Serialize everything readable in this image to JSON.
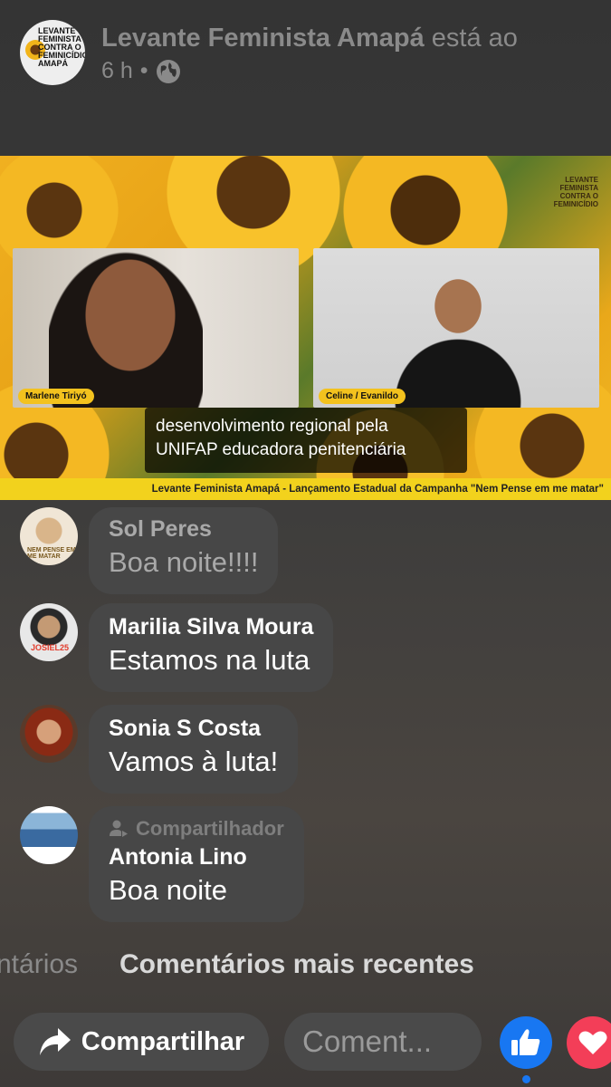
{
  "header": {
    "page_name": "Levante Feminista Amapá",
    "status_suffix": "está ao",
    "time": "6 h",
    "separator": "•",
    "privacy_icon": "globe-icon",
    "avatar_text": "LEVANTE FEMINISTA CONTRA O FEMINICÍDIO AMAPÁ"
  },
  "video": {
    "logo_text": "LEVANTE FEMINISTA CONTRA O FEMINICÍDIO",
    "left_name": "Marlene Tiriyó",
    "right_name": "Celine / Evanildo",
    "caption_line1": "desenvolvimento regional pela",
    "caption_line2": "UNIFAP educadora penitenciária",
    "banner": "Levante Feminista Amapá - Lançamento Estadual da Campanha \"Nem Pense em me matar\""
  },
  "comments": [
    {
      "author": "Sol Peres",
      "text": "Boa noite!!!!",
      "dimmed": true,
      "avatar_text": "NEM PENSE EM ME MATAR"
    },
    {
      "author": "Marilia Silva Moura",
      "text": "Estamos na luta",
      "avatar_text": "JOSIEL25"
    },
    {
      "author": "Sonia S Costa",
      "text": "Vamos à luta!"
    },
    {
      "author": "Antonia Lino",
      "text": "Boa noite",
      "badge": "Compartilhador",
      "badge_icon": "person-share-icon"
    }
  ],
  "tabs": {
    "previous": "ntários",
    "current": "Comentários mais recentes"
  },
  "actions": {
    "share_label": "Compartilhar",
    "share_icon": "share-arrow-icon",
    "comment_placeholder": "Coment...",
    "like_icon": "thumbs-up-icon",
    "love_icon": "heart-icon",
    "colors": {
      "like": "#1877f2",
      "love": "#f33e58",
      "banner": "#f2d21d"
    }
  }
}
